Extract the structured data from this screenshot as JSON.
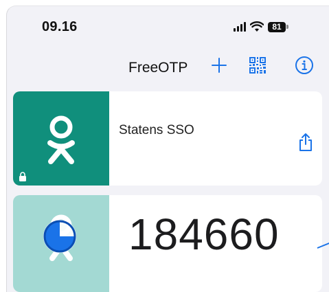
{
  "status_bar": {
    "time": "09.16",
    "battery": "81"
  },
  "header": {
    "title": "FreeOTP"
  },
  "tokens": [
    {
      "name": "Statens  SSO",
      "icon": "odnoklassniki-logo",
      "color": "#108f7c",
      "locked": true
    },
    {
      "code": "184660",
      "icon": "odnoklassniki-logo-with-timer",
      "color": "#a3d9d3",
      "timer_color": "#1a73e8"
    }
  ],
  "colors": {
    "accent": "#1a73e8",
    "background": "#f2f2f7"
  }
}
